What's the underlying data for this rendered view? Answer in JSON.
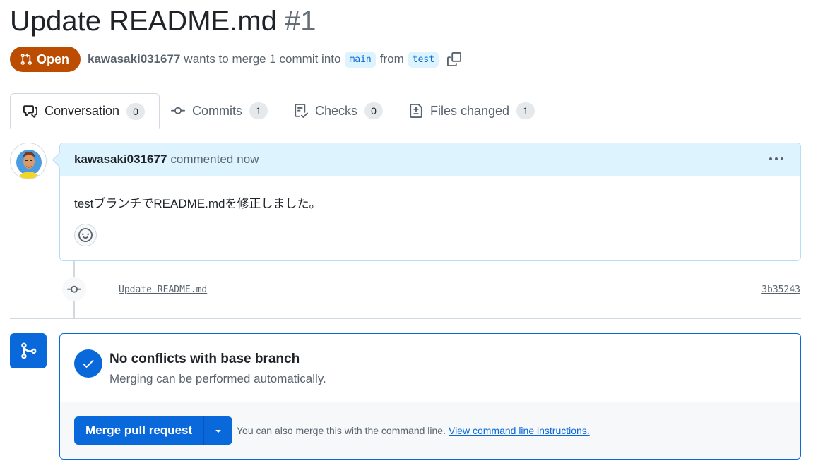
{
  "pr": {
    "title": "Update README.md",
    "number": "#1",
    "state": "Open",
    "author": "kawasaki031677",
    "meta_text": "wants to merge 1 commit into",
    "base_branch": "main",
    "from_text": "from",
    "head_branch": "test"
  },
  "tabs": [
    {
      "label": "Conversation",
      "count": "0",
      "icon": "comment-discussion-icon",
      "active": true
    },
    {
      "label": "Commits",
      "count": "1",
      "icon": "commit-icon"
    },
    {
      "label": "Checks",
      "count": "0",
      "icon": "checklist-icon"
    },
    {
      "label": "Files changed",
      "count": "1",
      "icon": "diff-icon"
    }
  ],
  "comment": {
    "author": "kawasaki031677",
    "action": "commented",
    "time": "now",
    "body": "testブランチでREADME.mdを修正しました。"
  },
  "commit": {
    "message": "Update README.md",
    "sha": "3b35243"
  },
  "merge": {
    "title": "No conflicts with base branch",
    "subtitle": "Merging can be performed automatically.",
    "button_label": "Merge pull request",
    "help_text": "You can also merge this with the command line.",
    "help_link": "View command line instructions."
  },
  "colors": {
    "open_state": "#bc4c00",
    "accent": "#0969da",
    "comment_header": "#ddf4ff"
  }
}
